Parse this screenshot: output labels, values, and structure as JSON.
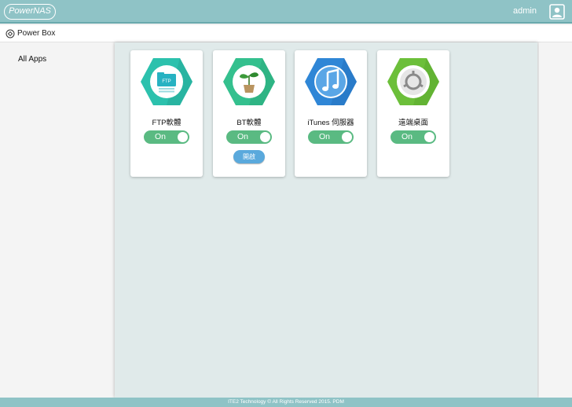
{
  "header": {
    "logo_text": "PowerNAS",
    "user_name": "admin",
    "colors": {
      "bar": "#8fc3c6",
      "toggle": "#5aba82",
      "button": "#5aa9dc"
    }
  },
  "subheader": {
    "title": "Power Box",
    "icon": "power-box-icon"
  },
  "sidebar": {
    "items": [
      {
        "label": "All Apps"
      }
    ]
  },
  "apps": [
    {
      "name": "FTP軟體",
      "icon": "ftp-icon",
      "toggle": "On"
    },
    {
      "name": "BT軟體",
      "icon": "sprout-icon",
      "toggle": "On",
      "button": "開啟"
    },
    {
      "name": "iTunes 伺服器",
      "icon": "music-note-icon",
      "toggle": "On"
    },
    {
      "name": "遠端桌面",
      "icon": "remote-desktop-icon",
      "toggle": "On"
    }
  ],
  "footer": {
    "text": "ITE2 Technology © All Rights Reserved 2015. PDM"
  }
}
